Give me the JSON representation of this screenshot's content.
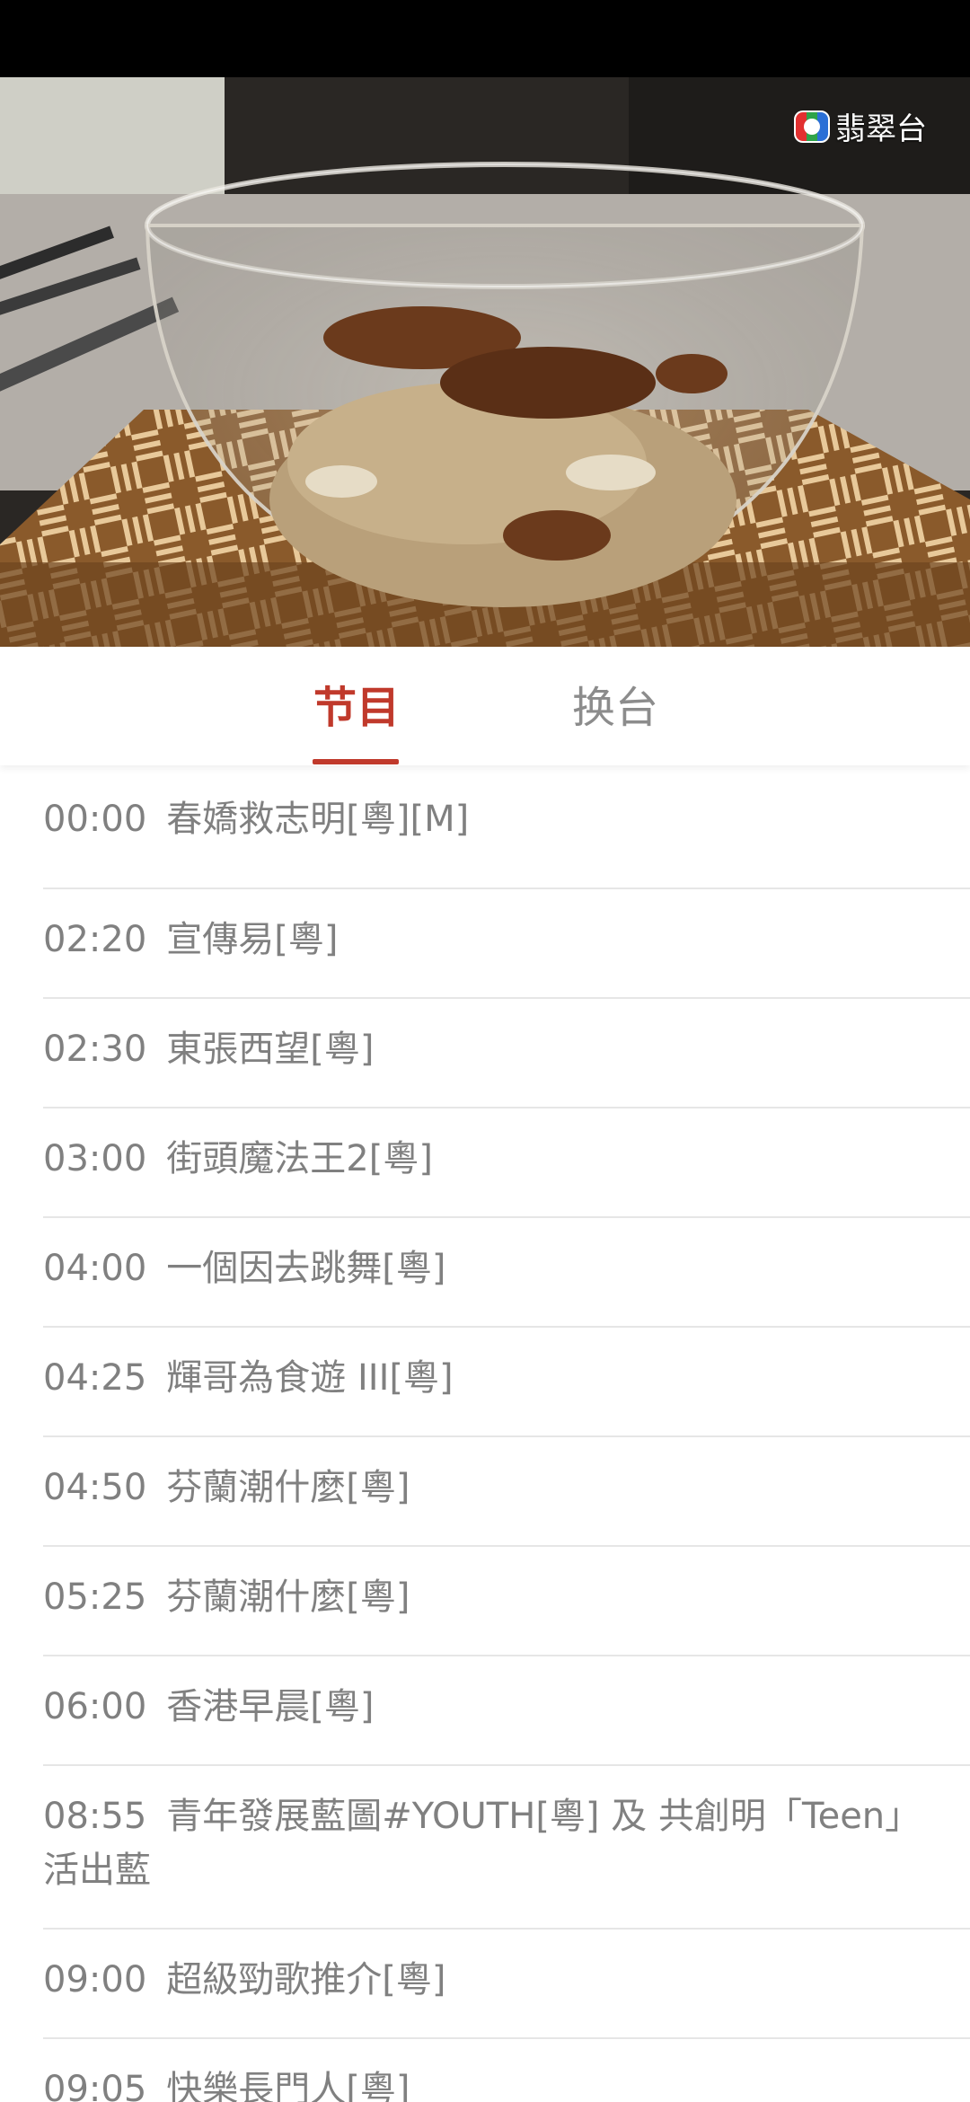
{
  "video": {
    "channel_logo_text": "翡翠台"
  },
  "tabs": [
    {
      "label": "节目",
      "active": true
    },
    {
      "label": "换台",
      "active": false
    }
  ],
  "schedule": [
    {
      "time": "00:00",
      "title": "春嬌救志明[粵][M]"
    },
    {
      "time": "02:20",
      "title": "宣傳易[粵]"
    },
    {
      "time": "02:30",
      "title": "東張西望[粵]"
    },
    {
      "time": "03:00",
      "title": "街頭魔法王2[粵]"
    },
    {
      "time": "04:00",
      "title": "一個因去跳舞[粵]"
    },
    {
      "time": "04:25",
      "title": "輝哥為食遊 III[粵]"
    },
    {
      "time": "04:50",
      "title": "芬蘭潮什麼[粵]"
    },
    {
      "time": "05:25",
      "title": "芬蘭潮什麼[粵]"
    },
    {
      "time": "06:00",
      "title": "香港早晨[粵]"
    },
    {
      "time": "08:55",
      "title": "青年發展藍圖#YOUTH[粵] 及 共創明「Teen」活出藍"
    },
    {
      "time": "09:00",
      "title": "超級勁歌推介[粵]"
    },
    {
      "time": "09:05",
      "title": "快樂長門人[粵]"
    }
  ],
  "colors": {
    "accent": "#c0392b",
    "text": "#808080",
    "divider": "#e6e6e6"
  }
}
